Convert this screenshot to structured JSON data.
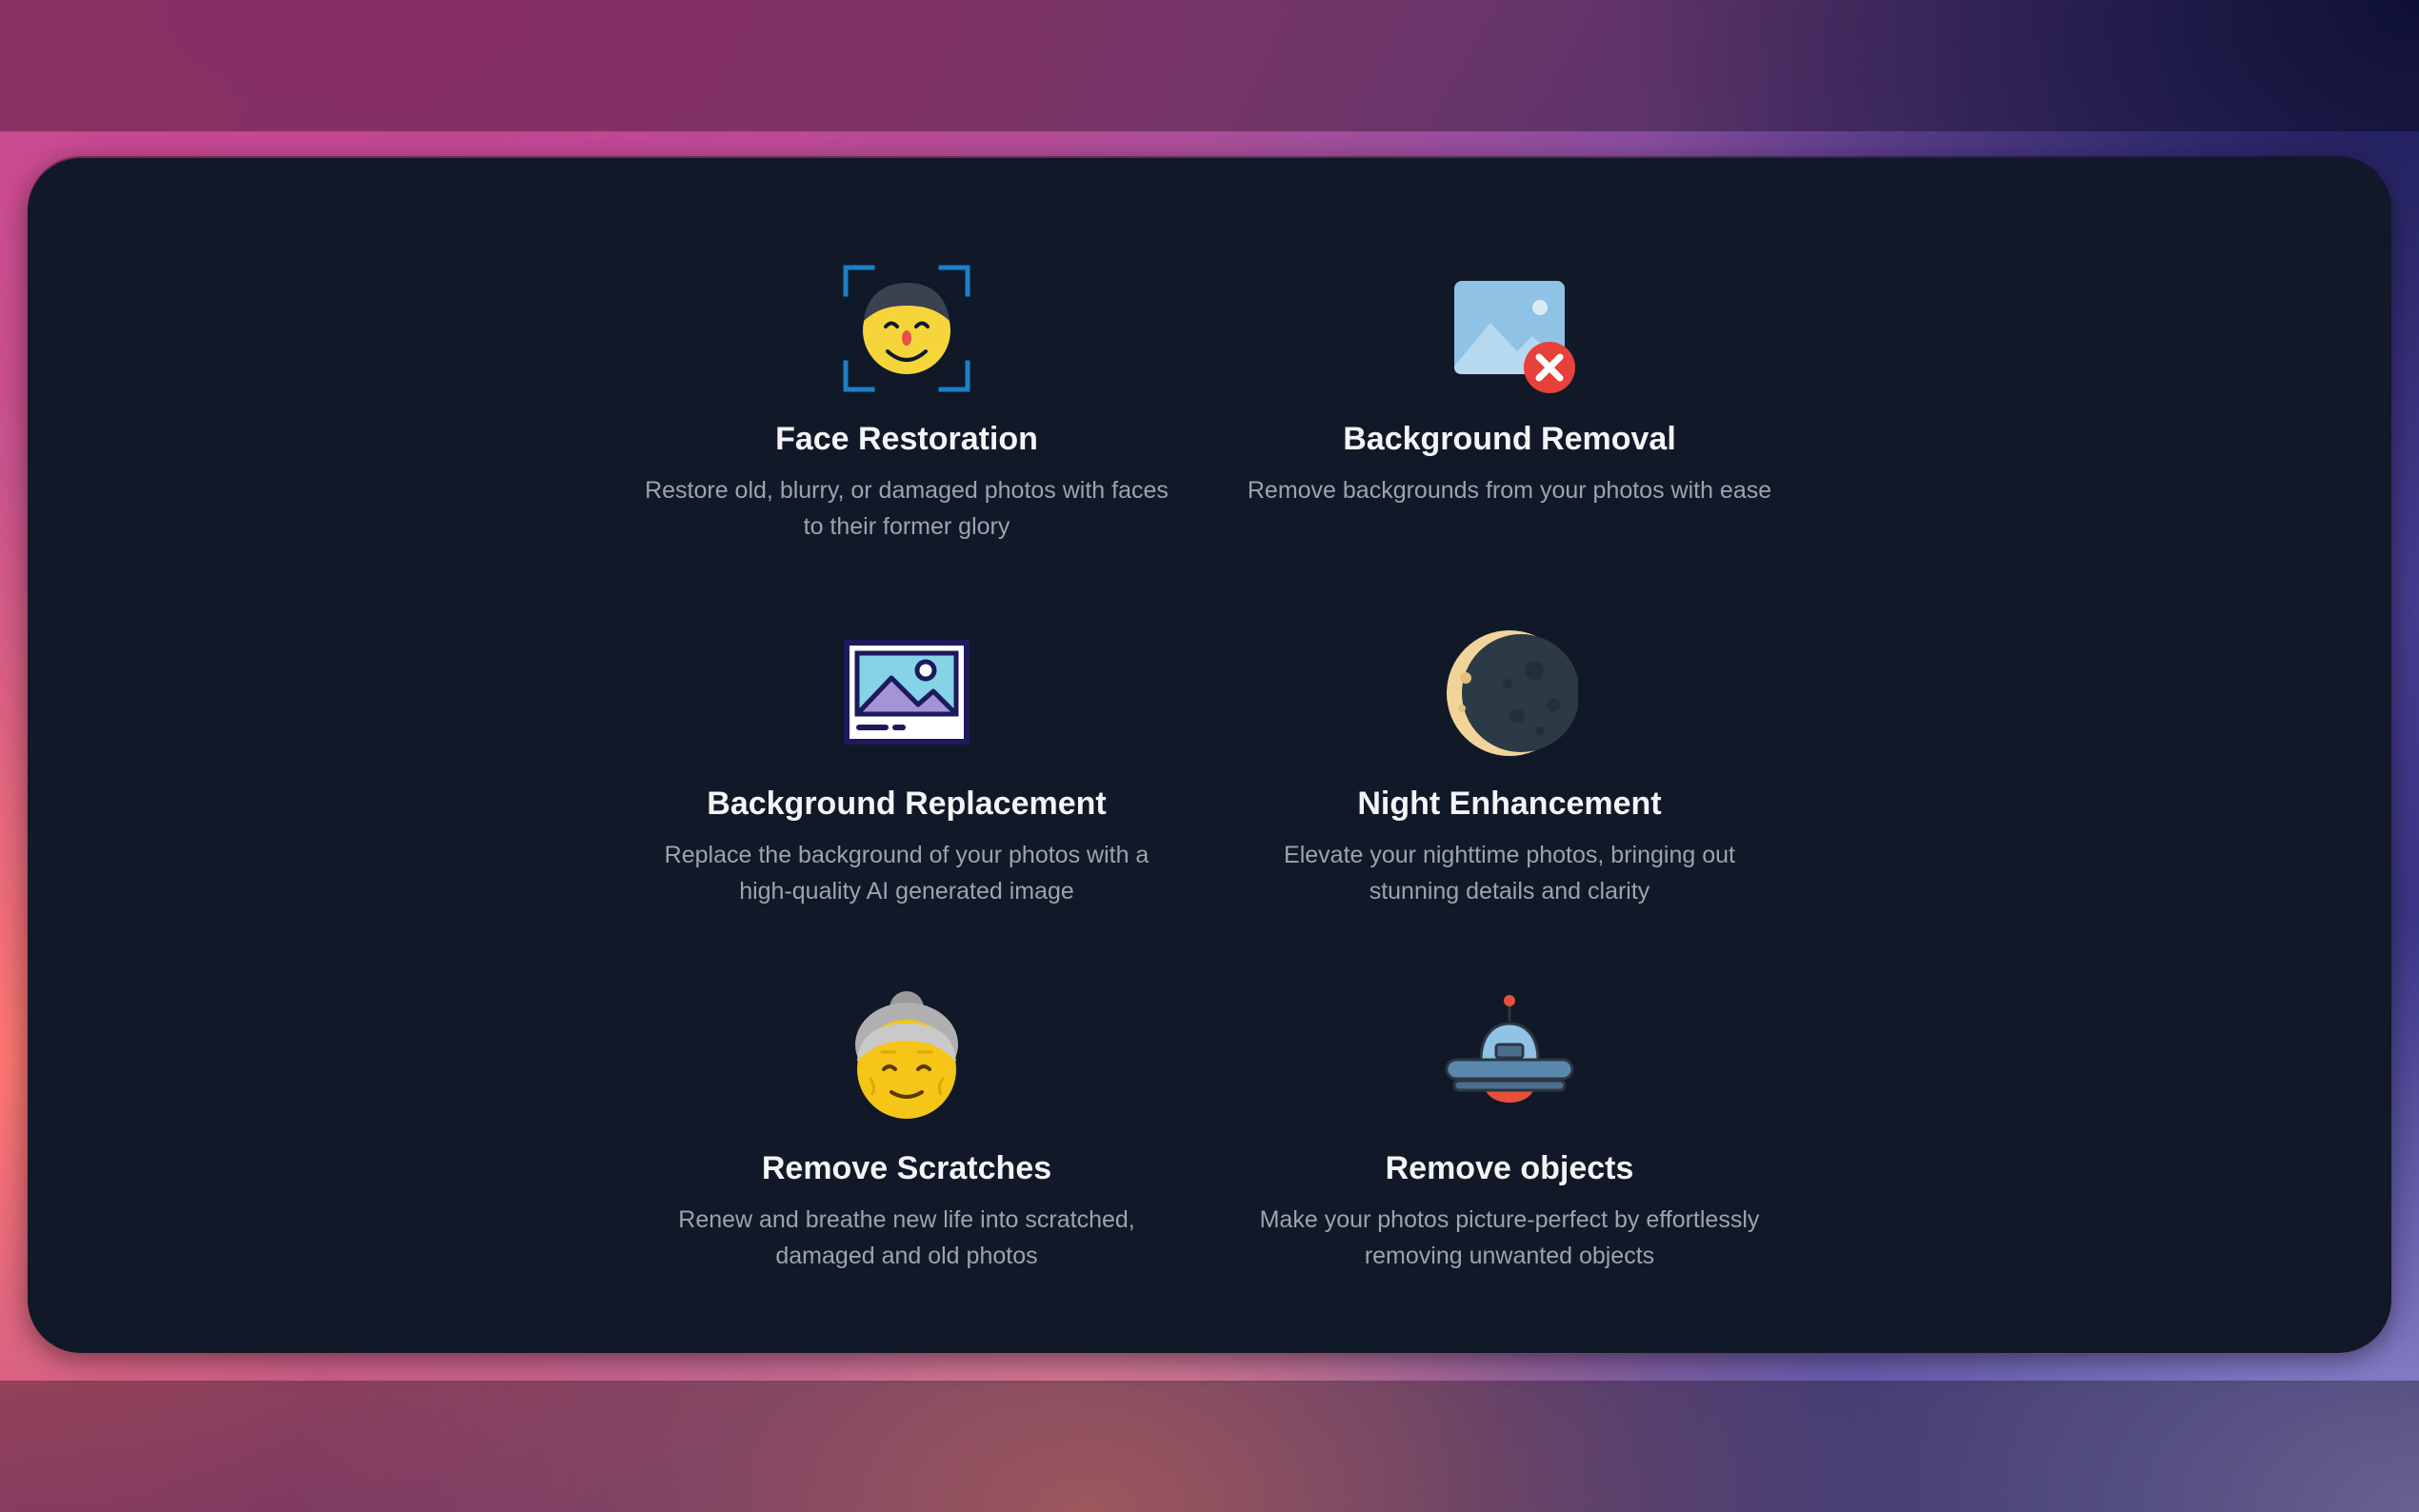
{
  "features": [
    {
      "title": "Face Restoration",
      "description": "Restore old, blurry, or damaged photos with faces to their former glory",
      "icon": "face-scan-icon"
    },
    {
      "title": "Background Removal",
      "description": "Remove backgrounds from your photos with ease",
      "icon": "image-remove-icon"
    },
    {
      "title": "Background Replacement",
      "description": "Replace the background of your photos with a high-quality AI generated image",
      "icon": "framed-picture-icon"
    },
    {
      "title": "Night Enhancement",
      "description": "Elevate your nighttime photos, bringing out stunning details and clarity",
      "icon": "crescent-moon-icon"
    },
    {
      "title": "Remove Scratches",
      "description": "Renew and breathe new life into scratched, damaged and old photos",
      "icon": "old-woman-icon"
    },
    {
      "title": "Remove objects",
      "description": "Make your photos picture-perfect by effortlessly removing unwanted objects",
      "icon": "ufo-icon"
    }
  ],
  "colors": {
    "card_background": "#111827",
    "title_text": "#f3f4f6",
    "description_text": "#9ca3af"
  }
}
